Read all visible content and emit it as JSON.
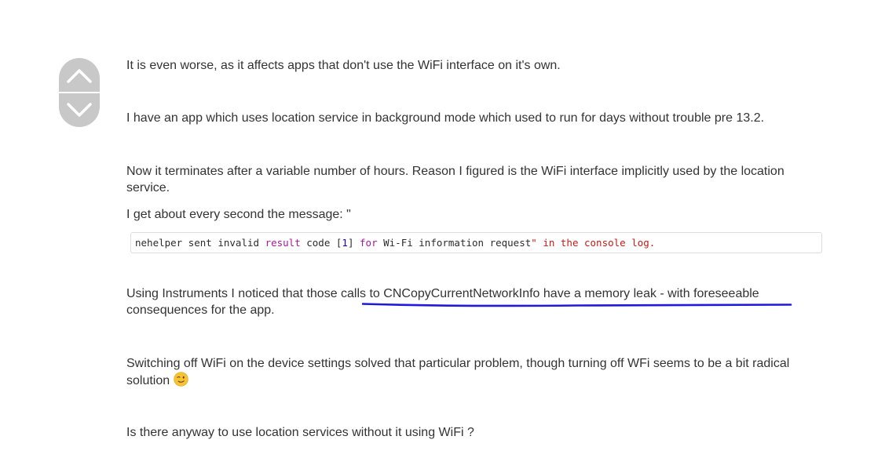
{
  "post": {
    "paragraphs": {
      "p1": "It is even worse, as it affects apps that don't use the WiFi interface on it's own.",
      "p2": "I have an app which uses location service in background mode which used to run for days without trouble pre 13.2.",
      "p3": "Now it terminates after a variable number of hours. Reason I figured is the WiFi interface implicitly used by the location service.",
      "p4": "I get about every second the message:  \"",
      "p5": "Using Instruments I noticed that those calls to CNCopyCurrentNetworkInfo have a memory leak - with foreseeable consequences for the app.",
      "p6": "Switching off WiFi on the device settings solved that particular problem, though turning off WFi seems to be a bit radical solution",
      "p7": "Is there anyway to use location services without it using WiFi ?"
    },
    "code": {
      "t1": "nehelper sent invalid ",
      "t2": "result",
      "t3": " code [",
      "t4": "1",
      "t5": "] ",
      "t6": "for",
      "t7": " Wi-Fi information request",
      "t8": "\" in the console log."
    }
  },
  "icons": {
    "vote_up": "chevron-up-icon",
    "vote_down": "chevron-down-icon",
    "emoji": "winking-face-emoji"
  },
  "colors": {
    "annotation_underline": "#1f1adb",
    "vote_button": "#c8c8c8",
    "code_keyword": "#a8189c",
    "code_string": "#c41a16",
    "code_number": "#1c00cf"
  }
}
